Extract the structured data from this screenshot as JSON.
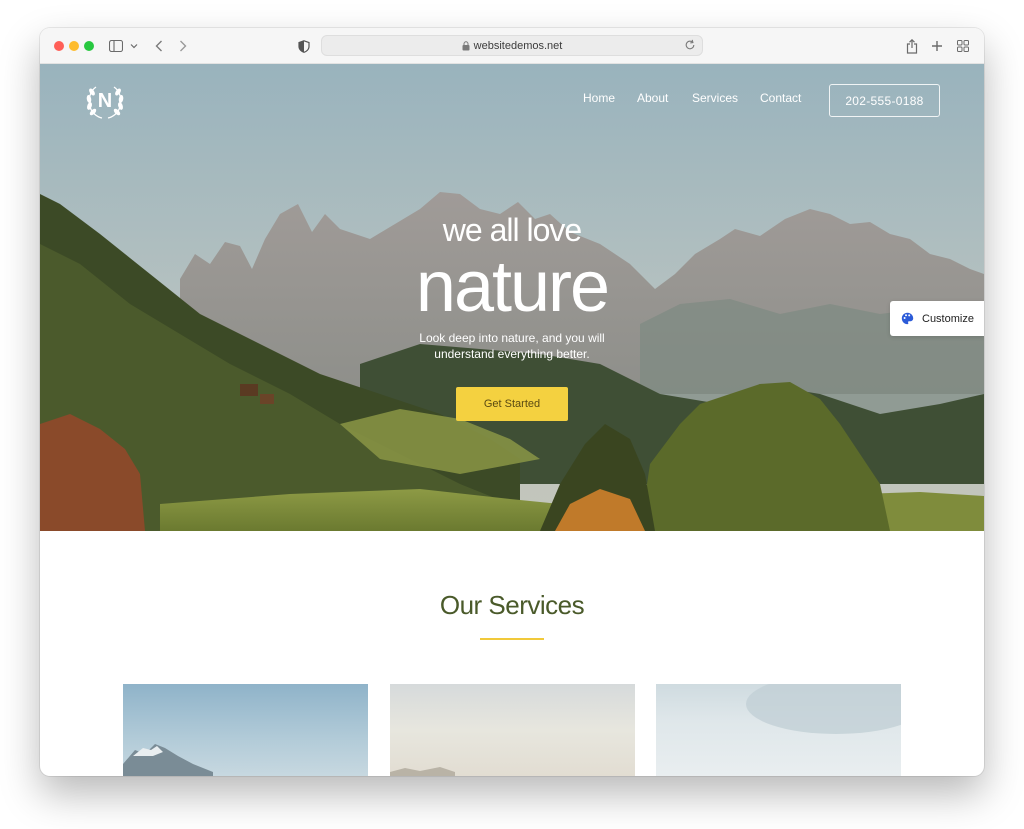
{
  "browser": {
    "url": "websitedemos.net",
    "icons": [
      "sidebar-icon",
      "chevron-down-icon",
      "back-icon",
      "forward-icon",
      "shield-icon",
      "lock-icon",
      "reload-icon",
      "share-icon",
      "plus-icon",
      "tabs-grid-icon"
    ]
  },
  "site": {
    "logo_letter": "N",
    "nav": {
      "home": "Home",
      "about": "About",
      "services": "Services",
      "contact": "Contact"
    },
    "phone": "202-555-0188",
    "hero": {
      "subtitle": "we all love",
      "title": "nature",
      "description": "Look deep into nature, and you will understand everything better.",
      "cta": "Get Started"
    },
    "customize": "Customize",
    "services": {
      "title": "Our Services"
    }
  },
  "colors": {
    "accent": "#f4d140",
    "heading_green": "#4a5a2a",
    "underline": "#f1c93a"
  }
}
